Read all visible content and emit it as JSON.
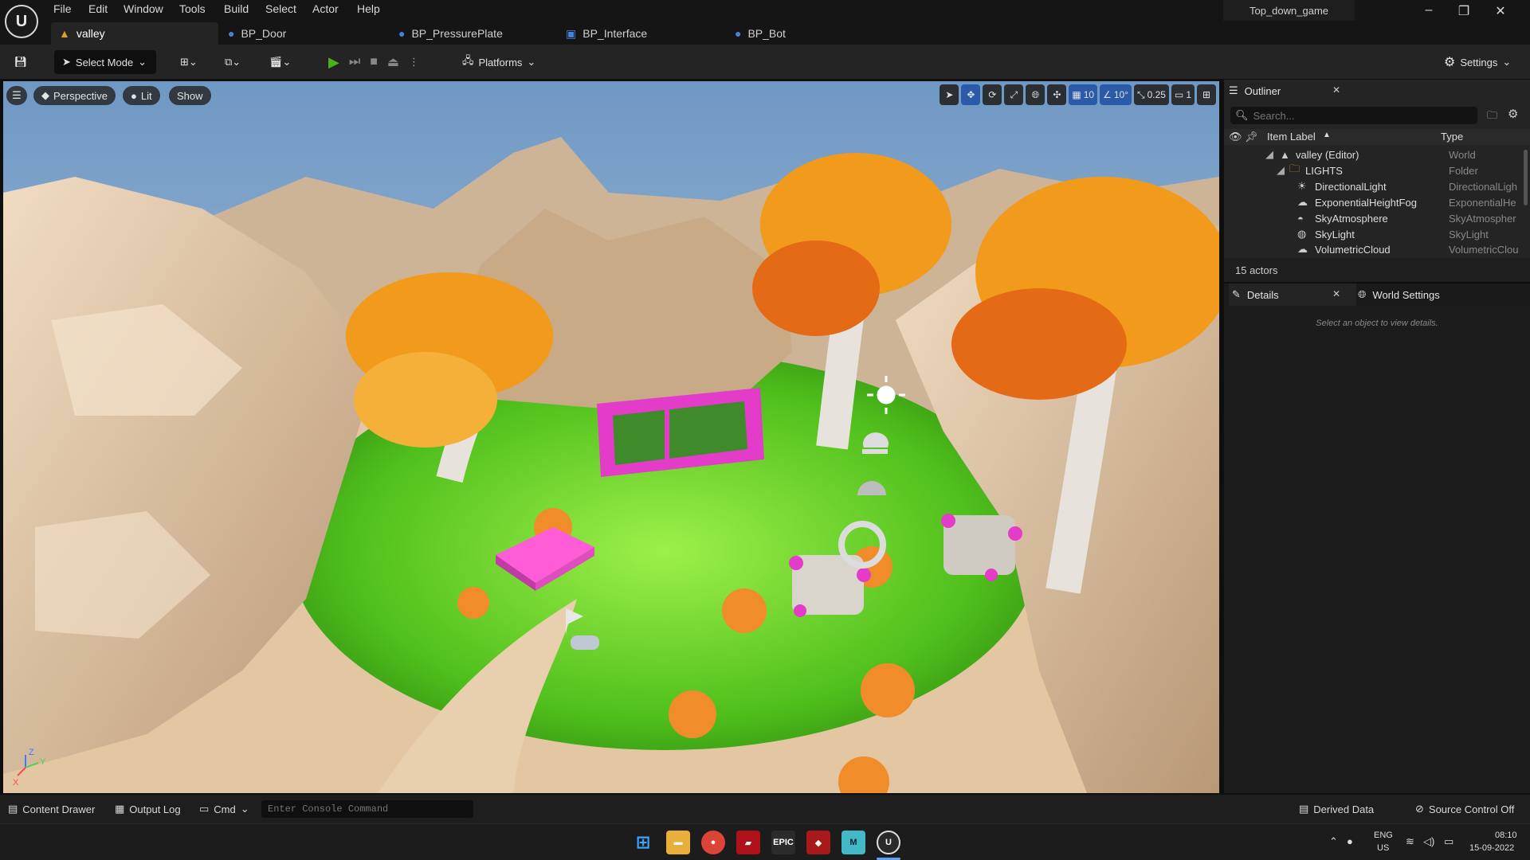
{
  "menu": [
    "File",
    "Edit",
    "Window",
    "Tools",
    "Build",
    "Select",
    "Actor",
    "Help"
  ],
  "project_name": "Top_down_game",
  "tabs": [
    {
      "label": "valley",
      "icon": "level-icon"
    },
    {
      "label": "BP_Door",
      "icon": "blueprint-icon"
    },
    {
      "label": "BP_PressurePlate",
      "icon": "blueprint-icon"
    },
    {
      "label": "BP_Interface",
      "icon": "interface-icon"
    },
    {
      "label": "BP_Bot",
      "icon": "blueprint-icon"
    }
  ],
  "toolbar": {
    "select_mode": "Select Mode",
    "platforms": "Platforms",
    "settings": "Settings"
  },
  "viewport": {
    "perspective": "Perspective",
    "lit": "Lit",
    "show": "Show",
    "grid_snap": "10",
    "rotation_snap": "10°",
    "scale_snap": "0.25",
    "camera_speed": "1"
  },
  "outliner": {
    "title": "Outliner",
    "search_placeholder": "Search...",
    "col_label": "Item Label",
    "col_type": "Type",
    "rows": [
      {
        "label": "valley (Editor)",
        "type": "World"
      },
      {
        "label": "LIGHTS",
        "type": "Folder"
      },
      {
        "label": "DirectionalLight",
        "type": "DirectionalLigh"
      },
      {
        "label": "ExponentialHeightFog",
        "type": "ExponentialHe"
      },
      {
        "label": "SkyAtmosphere",
        "type": "SkyAtmospher"
      },
      {
        "label": "SkyLight",
        "type": "SkyLight"
      },
      {
        "label": "VolumetricCloud",
        "type": "VolumetricClou"
      }
    ],
    "actor_count": "15 actors"
  },
  "details": {
    "tab_details": "Details",
    "tab_world": "World Settings",
    "empty_msg": "Select an object to view details."
  },
  "statusbar": {
    "content_drawer": "Content Drawer",
    "output_log": "Output Log",
    "cmd": "Cmd",
    "console_placeholder": "Enter Console Command",
    "derived_data": "Derived Data",
    "source_control": "Source Control Off"
  },
  "taskbar": {
    "lang": "ENG",
    "region": "US",
    "time": "08:10",
    "date": "15-09-2022"
  },
  "colors": {
    "accent_blue": "#2a5aa8",
    "play_green": "#4caf20"
  }
}
